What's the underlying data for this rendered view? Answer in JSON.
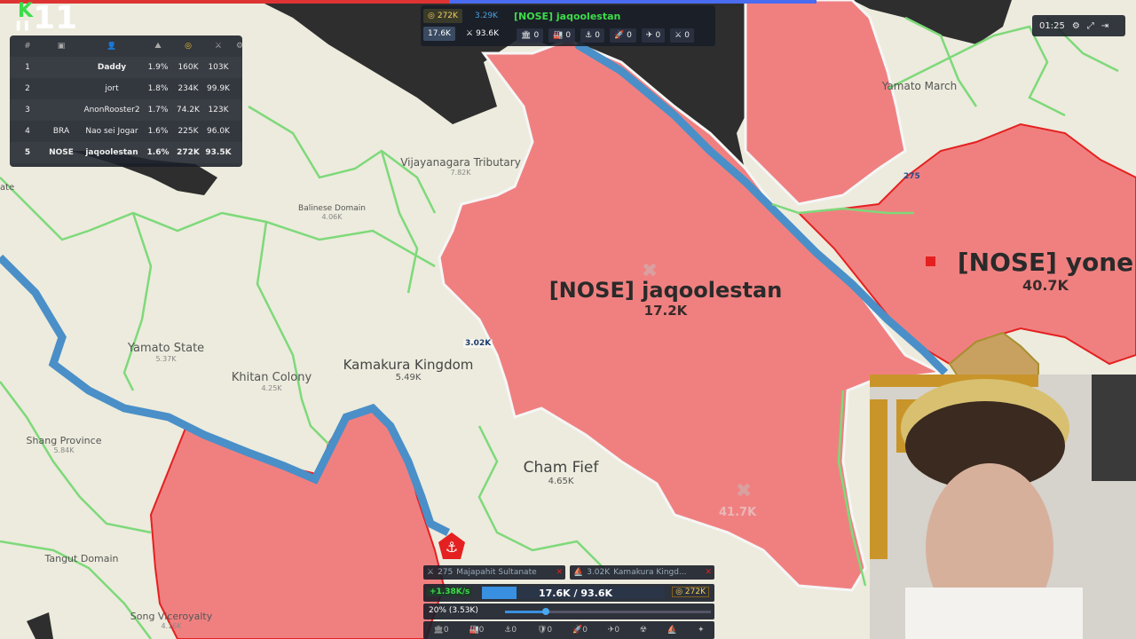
{
  "stream": {
    "score_digits": "11"
  },
  "leaderboard": {
    "headers": [
      "#",
      "",
      "",
      "",
      "",
      "",
      ""
    ],
    "rows": [
      {
        "rank": "1",
        "clan": "",
        "name": "Daddy",
        "pct": "1.9%",
        "gold": "160K",
        "troops": "103K"
      },
      {
        "rank": "2",
        "clan": "",
        "name": "jort",
        "pct": "1.8%",
        "gold": "234K",
        "troops": "99.9K"
      },
      {
        "rank": "3",
        "clan": "",
        "name": "AnonRooster2",
        "pct": "1.7%",
        "gold": "74.2K",
        "troops": "123K"
      },
      {
        "rank": "4",
        "clan": "BRA",
        "name": "Nao sei Jogar",
        "pct": "1.6%",
        "gold": "225K",
        "troops": "96.0K"
      },
      {
        "rank": "5",
        "clan": "NOSE",
        "name": "jaqoolestan",
        "pct": "1.6%",
        "gold": "272K",
        "troops": "93.5K"
      }
    ]
  },
  "player_info": {
    "gold": "272K",
    "pop_rate": "3.29K",
    "name": "[NOSE] jaqoolestan",
    "troops": "17.6K",
    "max_troops": "93.6K",
    "counts": [
      "0",
      "0",
      "0",
      "0",
      "0",
      "0"
    ]
  },
  "timer": {
    "time": "01:25"
  },
  "map_labels": [
    {
      "name": "Vijayanagara Tributary",
      "troops": "7.82K"
    },
    {
      "name": "Balinese Domain",
      "troops": "4.06K"
    },
    {
      "name": "Yamato March",
      "troops": ""
    },
    {
      "name": "Yamato State",
      "troops": "5.37K"
    },
    {
      "name": "Khitan Colony",
      "troops": "4.25K"
    },
    {
      "name": "Kamakura Kingdom",
      "troops": "5.49K"
    },
    {
      "name": "Shang Province",
      "troops": "5.84K"
    },
    {
      "name": "Cham Fief",
      "troops": "4.65K"
    },
    {
      "name": "Tangut Domain",
      "troops": ""
    },
    {
      "name": "Song Viceroyalty",
      "troops": "4.16K"
    }
  ],
  "players_on_map": [
    {
      "name": "[NOSE] jaqoolestan",
      "troops": "17.2K"
    },
    {
      "name": "[NOSE] yone",
      "troops": "40.7K"
    }
  ],
  "floating_numbers": {
    "boat_troops": "3.02K",
    "incoming": "41.7K",
    "edge_275": "275",
    "edge_ate": "ate"
  },
  "attacks": [
    {
      "troops": "275",
      "target": "Majapahit Sultanate"
    },
    {
      "troops": "3.02K",
      "target": "Kamakura Kingd..."
    }
  ],
  "bottom_bar": {
    "rate": "+1.38K/s",
    "troops_ratio": "17.6K / 93.6K",
    "gold": "272K",
    "attack_ratio": "20% (3.53K)",
    "attack_ratio_fraction": 0.2,
    "troop_fill_fraction": 0.19,
    "counts": [
      "0",
      "0",
      "0",
      "0",
      "0",
      "0"
    ]
  },
  "colors": {
    "player": "#f08080",
    "land": "#ecebdd",
    "water": "#2f2f2f",
    "river": "#4a8fc8",
    "border_green": "#7ed97a"
  }
}
